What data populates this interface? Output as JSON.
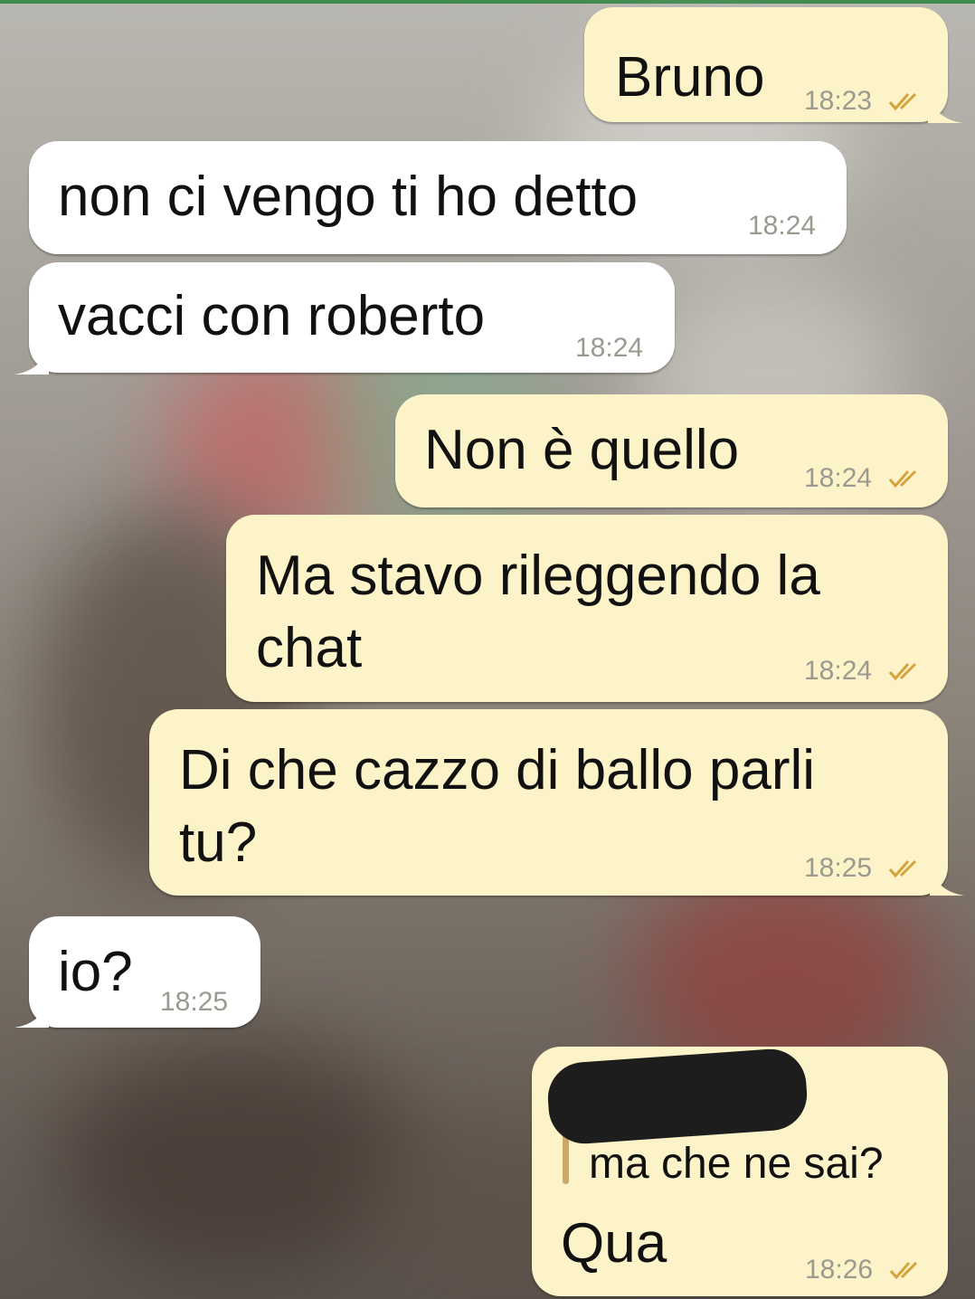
{
  "chat": {
    "messages": [
      {
        "dir": "out",
        "text": "Bruno",
        "time": "18:23",
        "status": "read"
      },
      {
        "dir": "in",
        "text": "non ci vengo ti ho detto",
        "time": "18:24"
      },
      {
        "dir": "in",
        "text": "vacci con roberto",
        "time": "18:24"
      },
      {
        "dir": "out",
        "text": "Non è quello",
        "time": "18:24",
        "status": "read"
      },
      {
        "dir": "out",
        "text_line1": "Ma stavo rileggendo la",
        "text_line2": "chat",
        "time": "18:24",
        "status": "read"
      },
      {
        "dir": "out",
        "text_line1": "Di che cazzo di ballo parli",
        "text_line2": "tu?",
        "time": "18:25",
        "status": "read"
      },
      {
        "dir": "in",
        "text": "io?",
        "time": "18:25"
      },
      {
        "dir": "out",
        "quote": {
          "author": "[redacted]",
          "text": "ma che ne sai?"
        },
        "text": "Qua",
        "time": "18:26",
        "status": "read"
      }
    ]
  },
  "colors": {
    "outgoing_bubble": "#fdf3c8",
    "incoming_bubble": "#ffffff",
    "timestamp": "#9a9a90",
    "read_ticks": "#d5a23c",
    "quote_bar": "#c9a86a"
  },
  "icons": {
    "read_receipt": "double-check-icon"
  }
}
